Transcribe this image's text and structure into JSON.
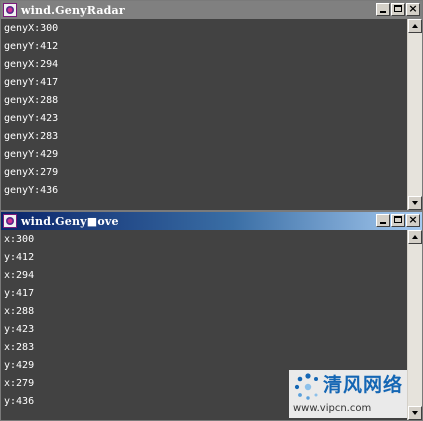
{
  "windows": [
    {
      "title": "wind.GenyRadar",
      "active": false,
      "lines": [
        "genyX:300",
        "genyY:412",
        "genyX:294",
        "genyY:417",
        "genyX:288",
        "genyY:423",
        "genyX:283",
        "genyY:429",
        "genyX:279",
        "genyY:436"
      ]
    },
    {
      "title": "wind.Geny■ove",
      "active": true,
      "lines": [
        "x:300",
        "y:412",
        "x:294",
        "y:417",
        "x:288",
        "y:423",
        "x:283",
        "y:429",
        "x:279",
        "y:436"
      ]
    }
  ],
  "caption_buttons": {
    "close_glyph": "×"
  },
  "icons": {
    "app": "flash-app-icon",
    "minimize": "minimize-icon",
    "maximize": "maximize-icon",
    "close": "close-icon",
    "scroll_up": "arrow-up-icon",
    "scroll_down": "arrow-down-icon",
    "watermark_logo": "dots-logo-icon"
  },
  "colors": {
    "console_bg": "#424242",
    "console_text": "#ffffff",
    "titlebar_inactive": "#808080",
    "titlebar_active_start": "#0a246a",
    "titlebar_active_end": "#a6caf0",
    "watermark_blue": "#1466b4"
  },
  "watermark": {
    "title": "清风网络",
    "url": "www.vipcn.com"
  }
}
